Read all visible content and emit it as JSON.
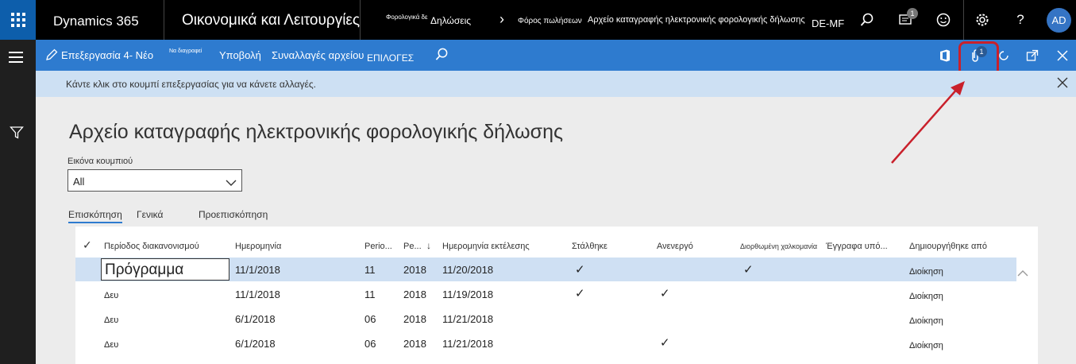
{
  "topbar": {
    "brand": "Dynamics 365",
    "module": "Οικονομικά και Λειτουργίες",
    "crumb1_small": "Φορολογικά δε",
    "crumb1": "Δηλώσεις",
    "crumb2": "Φόρος πωλήσεων",
    "crumb3": "Αρχείο καταγραφής ηλεκτρονικής φορολογικής δήλωσης",
    "company": "DE-MF",
    "notification_count": "1",
    "avatar_initials": "AD"
  },
  "actionbar": {
    "edit_label": "Επεξεργασία 4- Νέο",
    "delete_label": "Να διαγραφεί",
    "submit_label": "Υποβολή",
    "file_transactions_label": "Συναλλαγές αρχείου",
    "options_label": "ΕΠΙΛΟΓΕΣ",
    "attachment_count": "1"
  },
  "message": {
    "text": "Κάντε κλικ στο κουμπί επεξεργασίας για να κάνετε αλλαγές."
  },
  "page": {
    "title": "Αρχείο καταγραφής ηλεκτρονικής φορολογικής δήλωσης",
    "filter_label": "Εικόνα κουμπιού",
    "filter_value": "All"
  },
  "tabs": [
    "Επισκόπηση",
    "Γενικά",
    "Προεπισκόπηση"
  ],
  "grid": {
    "headers": [
      "Περίοδος διακανονισμού",
      "Ημερομηνία",
      "Perio...",
      "Pe...",
      "Ημερομηνία εκτέλεσης",
      "Στάλθηκε",
      "Ανενεργό",
      "Διορθωμένη χαλκομανία",
      "Έγγραφα υπό...",
      "Δημιουργήθηκε από"
    ],
    "rows": [
      {
        "period": "Πρόγραμμα",
        "date": "11/1/2018",
        "perio": "11",
        "pe": "2018",
        "run_date": "11/20/2018",
        "sent": "✓",
        "inactive": "",
        "corrected": "✓",
        "docs": "",
        "created_by": "Διοίκηση"
      },
      {
        "period": "Δευ",
        "date": "11/1/2018",
        "perio": "11",
        "pe": "2018",
        "run_date": "11/19/2018",
        "sent": "✓",
        "inactive": "✓",
        "corrected": "",
        "docs": "",
        "created_by": "Διοίκηση"
      },
      {
        "period": "Δευ",
        "date": "6/1/2018",
        "perio": "06",
        "pe": "2018",
        "run_date": "11/21/2018",
        "sent": "",
        "inactive": "",
        "corrected": "",
        "docs": "",
        "created_by": "Διοίκηση"
      },
      {
        "period": "Δευ",
        "date": "6/1/2018",
        "perio": "06",
        "pe": "2018",
        "run_date": "11/21/2018",
        "sent": "",
        "inactive": "✓",
        "corrected": "",
        "docs": "",
        "created_by": "Διοίκηση"
      }
    ]
  },
  "colors": {
    "accent": "#2e7bcf",
    "waffle": "#0d5eab",
    "message_bg": "#cde0f3",
    "highlight": "#c9202b"
  }
}
